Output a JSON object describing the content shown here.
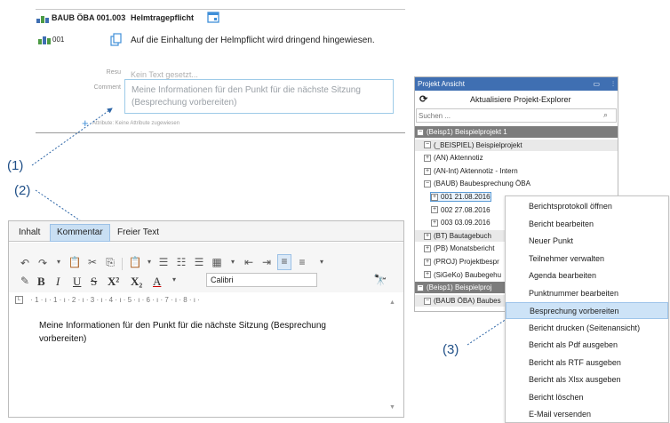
{
  "point_card": {
    "code": "BAUB ÖBA 001.003",
    "heading": "Helmtragepflicht",
    "sub_code": "001",
    "description": "Auf die Einhaltung der Helmpflicht wird dringend hingewiesen.",
    "label_result": "Resu",
    "result_value": "Kein Text gesetzt...",
    "label_comment": "Comment",
    "comment_value": "Meine Informationen für den Punkt für die nächste Sitzung (Besprechung vorbereiten)",
    "attributes_text": "Attribute: Keine Attribute zugewiesen"
  },
  "callouts": [
    "(1)",
    "(2)",
    "(3)"
  ],
  "editor": {
    "tabs": [
      "Inhalt",
      "Kommentar",
      "Freier Text"
    ],
    "active_tab": "Kommentar",
    "font_name": "Calibri",
    "ruler": "· 1 · ı · 1 · ı · 2 · ı · 3 · ı · 4 · ı · 5 · ı · 6 · ı · 7 · ı · 8 · ı ·",
    "text": "Meine Informationen für den Punkt für die nächste Sitzung (Besprechung vorbereiten)"
  },
  "project_panel": {
    "title": "Projekt Ansicht",
    "refresh_label": "Aktualisiere Projekt-Explorer",
    "search_placeholder": "Suchen ...",
    "tree": [
      {
        "label": "(Beisp1) Beispielprojekt 1",
        "style": "dark",
        "indent": 0,
        "sign": "−"
      },
      {
        "label": "(_BEISPIEL) Beispielprojekt",
        "style": "light",
        "indent": 1,
        "sign": "−"
      },
      {
        "label": "(AN) Aktennotiz",
        "style": "normal",
        "indent": 1,
        "sign": "+"
      },
      {
        "label": "(AN-Int) Aktennotiz - Intern",
        "style": "normal",
        "indent": 1,
        "sign": "+"
      },
      {
        "label": "(BAUB) Baubesprechung ÖBA",
        "style": "normal",
        "indent": 1,
        "sign": "−"
      },
      {
        "label": "001  21.08.2016",
        "style": "selected",
        "indent": 2,
        "sign": "+"
      },
      {
        "label": "002  27.08.2016",
        "style": "normal",
        "indent": 2,
        "sign": "+"
      },
      {
        "label": "003  03.09.2016",
        "style": "normal",
        "indent": 2,
        "sign": "+"
      },
      {
        "label": "(BT) Bautagebuch",
        "style": "light",
        "indent": 1,
        "sign": "+"
      },
      {
        "label": "(PB) Monatsbericht",
        "style": "normal",
        "indent": 1,
        "sign": "+"
      },
      {
        "label": "(PROJ) Projektbespr",
        "style": "normal",
        "indent": 1,
        "sign": "+"
      },
      {
        "label": "(SiGeKo) Baubegehu",
        "style": "normal",
        "indent": 1,
        "sign": "+"
      },
      {
        "label": "(Beisp1) Beispielproj",
        "style": "dark",
        "indent": 0,
        "sign": "−"
      },
      {
        "label": "(BAUB ÖBA) Baubes",
        "style": "light",
        "indent": 1,
        "sign": "−"
      }
    ]
  },
  "context_menu": {
    "items": [
      "Berichtsprotokoll öffnen",
      "Bericht bearbeiten",
      "Neuer Punkt",
      "Teilnehmer verwalten",
      "Agenda bearbeiten",
      "Punktnummer bearbeiten",
      "Besprechung vorbereiten",
      "Bericht drucken (Seitenansicht)",
      "Bericht als Pdf ausgeben",
      "Bericht als RTF ausgeben",
      "Bericht als Xlsx ausgeben",
      "Bericht löschen",
      "E-Mail versenden"
    ],
    "highlighted": "Besprechung vorbereiten"
  },
  "colors": {
    "accent": "#3f6fb2",
    "highlight": "#cde3f7",
    "callout": "#1f4f87"
  }
}
